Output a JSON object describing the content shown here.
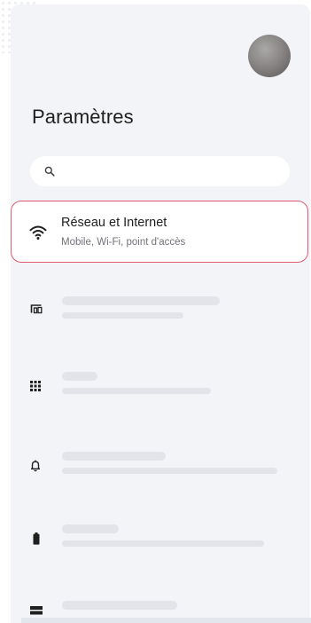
{
  "header": {
    "title": "Paramètres"
  },
  "search": {
    "placeholder": ""
  },
  "selected_item": {
    "label": "Réseau et Internet",
    "subtitle": "Mobile, Wi‑Fi, point d'accès",
    "icon": "wifi-icon"
  },
  "placeholder_items": [
    {
      "icon": "devices-icon"
    },
    {
      "icon": "apps-grid-icon"
    },
    {
      "icon": "bell-icon"
    },
    {
      "icon": "battery-icon"
    },
    {
      "icon": "storage-icon"
    }
  ],
  "colors": {
    "highlight_border": "#e15b70",
    "panel_background": "#f3f4f7",
    "skeleton": "#e2e4e9"
  }
}
